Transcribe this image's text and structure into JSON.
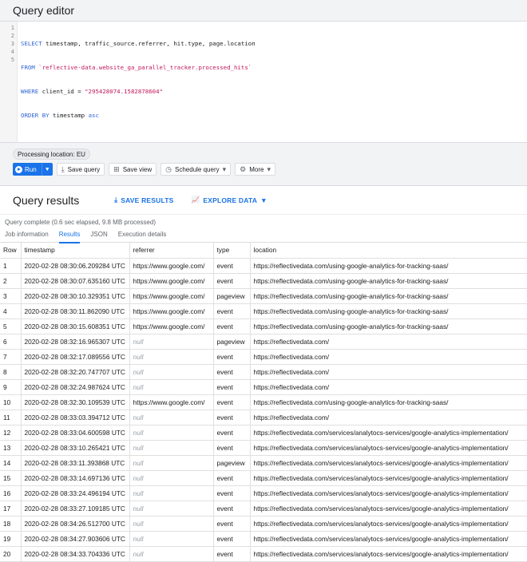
{
  "editor": {
    "title": "Query editor",
    "line_numbers": [
      "1",
      "2",
      "3",
      "4",
      "5"
    ]
  },
  "sql": {
    "l1_kw": "SELECT",
    "l1_rest": " timestamp, traffic_source.referrer, hit.type, page.location",
    "l2_kw": "FROM",
    "l2_rest": " `reflective-data.website_ga_parallel_tracker.processed_hits`",
    "l3_kw": "WHERE",
    "l3_mid": " client_id = ",
    "l3_str": "\"295428074.1582878604\"",
    "l4_kw": "ORDER BY",
    "l4_mid": " timestamp ",
    "l4_kw2": "asc"
  },
  "toolbar": {
    "processing_location": "Processing location: EU",
    "run_label": "Run",
    "save_query": "Save query",
    "save_view": "Save view",
    "schedule_query": "Schedule query",
    "more": "More"
  },
  "results": {
    "title": "Query results",
    "save_results": "SAVE RESULTS",
    "explore_data": "EXPLORE DATA",
    "status": "Query complete (0.6 sec elapsed, 9.8 MB processed)",
    "tabs": [
      "Job information",
      "Results",
      "JSON",
      "Execution details"
    ],
    "columns": [
      "Row",
      "timestamp",
      "referrer",
      "type",
      "location"
    ],
    "rows": [
      [
        "1",
        "2020-02-28 08:30:06.209284 UTC",
        "https://www.google.com/",
        "event",
        "https://reflectivedata.com/using-google-analytics-for-tracking-saas/"
      ],
      [
        "2",
        "2020-02-28 08:30:07.635160 UTC",
        "https://www.google.com/",
        "event",
        "https://reflectivedata.com/using-google-analytics-for-tracking-saas/"
      ],
      [
        "3",
        "2020-02-28 08:30:10.329351 UTC",
        "https://www.google.com/",
        "pageview",
        "https://reflectivedata.com/using-google-analytics-for-tracking-saas/"
      ],
      [
        "4",
        "2020-02-28 08:30:11.862090 UTC",
        "https://www.google.com/",
        "event",
        "https://reflectivedata.com/using-google-analytics-for-tracking-saas/"
      ],
      [
        "5",
        "2020-02-28 08:30:15.608351 UTC",
        "https://www.google.com/",
        "event",
        "https://reflectivedata.com/using-google-analytics-for-tracking-saas/"
      ],
      [
        "6",
        "2020-02-28 08:32:16.965307 UTC",
        "null",
        "pageview",
        "https://reflectivedata.com/"
      ],
      [
        "7",
        "2020-02-28 08:32:17.089556 UTC",
        "null",
        "event",
        "https://reflectivedata.com/"
      ],
      [
        "8",
        "2020-02-28 08:32:20.747707 UTC",
        "null",
        "event",
        "https://reflectivedata.com/"
      ],
      [
        "9",
        "2020-02-28 08:32:24.987624 UTC",
        "null",
        "event",
        "https://reflectivedata.com/"
      ],
      [
        "10",
        "2020-02-28 08:32:30.109539 UTC",
        "https://www.google.com/",
        "event",
        "https://reflectivedata.com/using-google-analytics-for-tracking-saas/"
      ],
      [
        "11",
        "2020-02-28 08:33:03.394712 UTC",
        "null",
        "event",
        "https://reflectivedata.com/"
      ],
      [
        "12",
        "2020-02-28 08:33:04.600598 UTC",
        "null",
        "event",
        "https://reflectivedata.com/services/analytocs-services/google-analytics-implementation/"
      ],
      [
        "13",
        "2020-02-28 08:33:10.265421 UTC",
        "null",
        "event",
        "https://reflectivedata.com/services/analytocs-services/google-analytics-implementation/"
      ],
      [
        "14",
        "2020-02-28 08:33:11.393868 UTC",
        "null",
        "pageview",
        "https://reflectivedata.com/services/analytocs-services/google-analytics-implementation/"
      ],
      [
        "15",
        "2020-02-28 08:33:14.697136 UTC",
        "null",
        "event",
        "https://reflectivedata.com/services/analytocs-services/google-analytics-implementation/"
      ],
      [
        "16",
        "2020-02-28 08:33:24.496194 UTC",
        "null",
        "event",
        "https://reflectivedata.com/services/analytocs-services/google-analytics-implementation/"
      ],
      [
        "17",
        "2020-02-28 08:33:27.109185 UTC",
        "null",
        "event",
        "https://reflectivedata.com/services/analytocs-services/google-analytics-implementation/"
      ],
      [
        "18",
        "2020-02-28 08:34:26.512700 UTC",
        "null",
        "event",
        "https://reflectivedata.com/services/analytocs-services/google-analytics-implementation/"
      ],
      [
        "19",
        "2020-02-28 08:34:27.903606 UTC",
        "null",
        "event",
        "https://reflectivedata.com/services/analytocs-services/google-analytics-implementation/"
      ],
      [
        "20",
        "2020-02-28 08:34:33.704336 UTC",
        "null",
        "event",
        "https://reflectivedata.com/services/analytocs-services/google-analytics-implementation/"
      ]
    ]
  }
}
